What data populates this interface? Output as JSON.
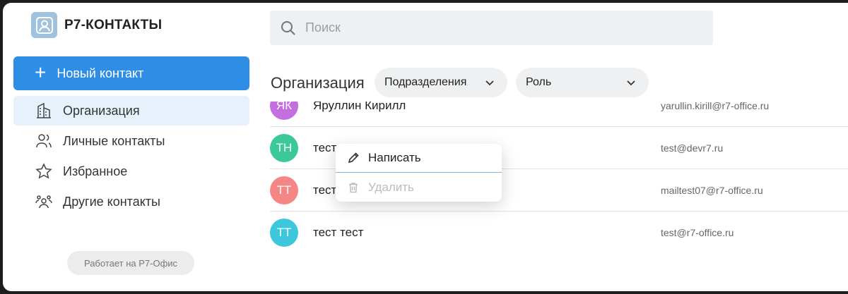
{
  "app": {
    "title": "Р7-КОНТАКТЫ"
  },
  "sidebar": {
    "new_contact_label": "Новый контакт",
    "items": [
      {
        "label": "Организация",
        "icon": "building-icon"
      },
      {
        "label": "Личные контакты",
        "icon": "users-icon"
      },
      {
        "label": "Избранное",
        "icon": "star-icon"
      },
      {
        "label": "Другие контакты",
        "icon": "group-icon"
      }
    ],
    "powered_by": "Работает на Р7-Офис"
  },
  "search": {
    "placeholder": "Поиск",
    "value": ""
  },
  "main": {
    "section_title": "Организация",
    "filters": [
      {
        "label": "Подразделения"
      },
      {
        "label": "Роль"
      }
    ]
  },
  "contacts": [
    {
      "initials": "ЯК",
      "name": "Яруллин Кирилл",
      "email": "yarullin.kirill@r7-office.ru",
      "color": "#c56ee0"
    },
    {
      "initials": "ТН",
      "name": "тест",
      "email": "test@devr7.ru",
      "color": "#3cc99a"
    },
    {
      "initials": "ТТ",
      "name": "тест",
      "email": "mailtest07@r7-office.ru",
      "color": "#f58686"
    },
    {
      "initials": "ТТ",
      "name": "тест тест",
      "email": "test@r7-office.ru",
      "color": "#3cc7dc"
    }
  ],
  "context_menu": {
    "write_label": "Написать",
    "delete_label": "Удалить"
  },
  "colors": {
    "accent": "#2e8ee6",
    "active_bg": "#e6f1fb"
  }
}
